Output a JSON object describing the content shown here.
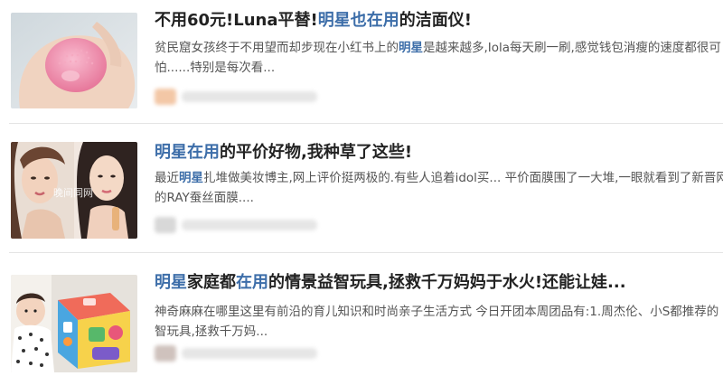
{
  "articles": [
    {
      "title_parts": [
        "不用60元!Luna平替!",
        "明星也在用",
        "的洁面仪!"
      ],
      "snippet_line1_parts": [
        "贫民窟女孩终于不用望而却步现在小红书上的",
        "明星",
        "是越来越多,Iola每天刷一刷,感觉钱包消瘦的速度都很可"
      ],
      "snippet_line2": "怕......特别是每次看...",
      "thumb_icon": "pink-silicone-facial-cleanser-in-hand-image",
      "avatar_color": "#f3c7a6"
    },
    {
      "title_parts": [
        "明星在用",
        "的平价好物,我种草了这些!"
      ],
      "snippet_line1_parts": [
        "最近",
        "明星",
        "扎堆做美妆博主,网上评价挺两极的.有些人追着idol买... 平价面膜围了一大堆,一眼就看到了新晋网红"
      ],
      "snippet_line2": "的RAY蚕丝面膜....",
      "thumb_watermark": "晚间同网",
      "thumb_icon": "celebrity-portrait-collage-image",
      "avatar_color": "#d8d8d8"
    },
    {
      "title_parts": [
        "明星",
        "家庭都",
        "在用",
        "的情景益智玩具,拯救千万妈妈于水火!还能让娃..."
      ],
      "snippet_line1": "神奇麻麻在哪里这里有前沿的育儿知识和时尚亲子生活方式 今日开团本周团品有:1.周杰伦、小S都推荐的",
      "snippet_line2": "智玩具,拯救千万妈...",
      "thumb_icon": "baby-with-colorful-toy-cube-image",
      "avatar_color": "#cfc2bd"
    }
  ],
  "colors": {
    "highlight": "#3d6ea9",
    "title": "#222222",
    "snippet": "#555555"
  }
}
